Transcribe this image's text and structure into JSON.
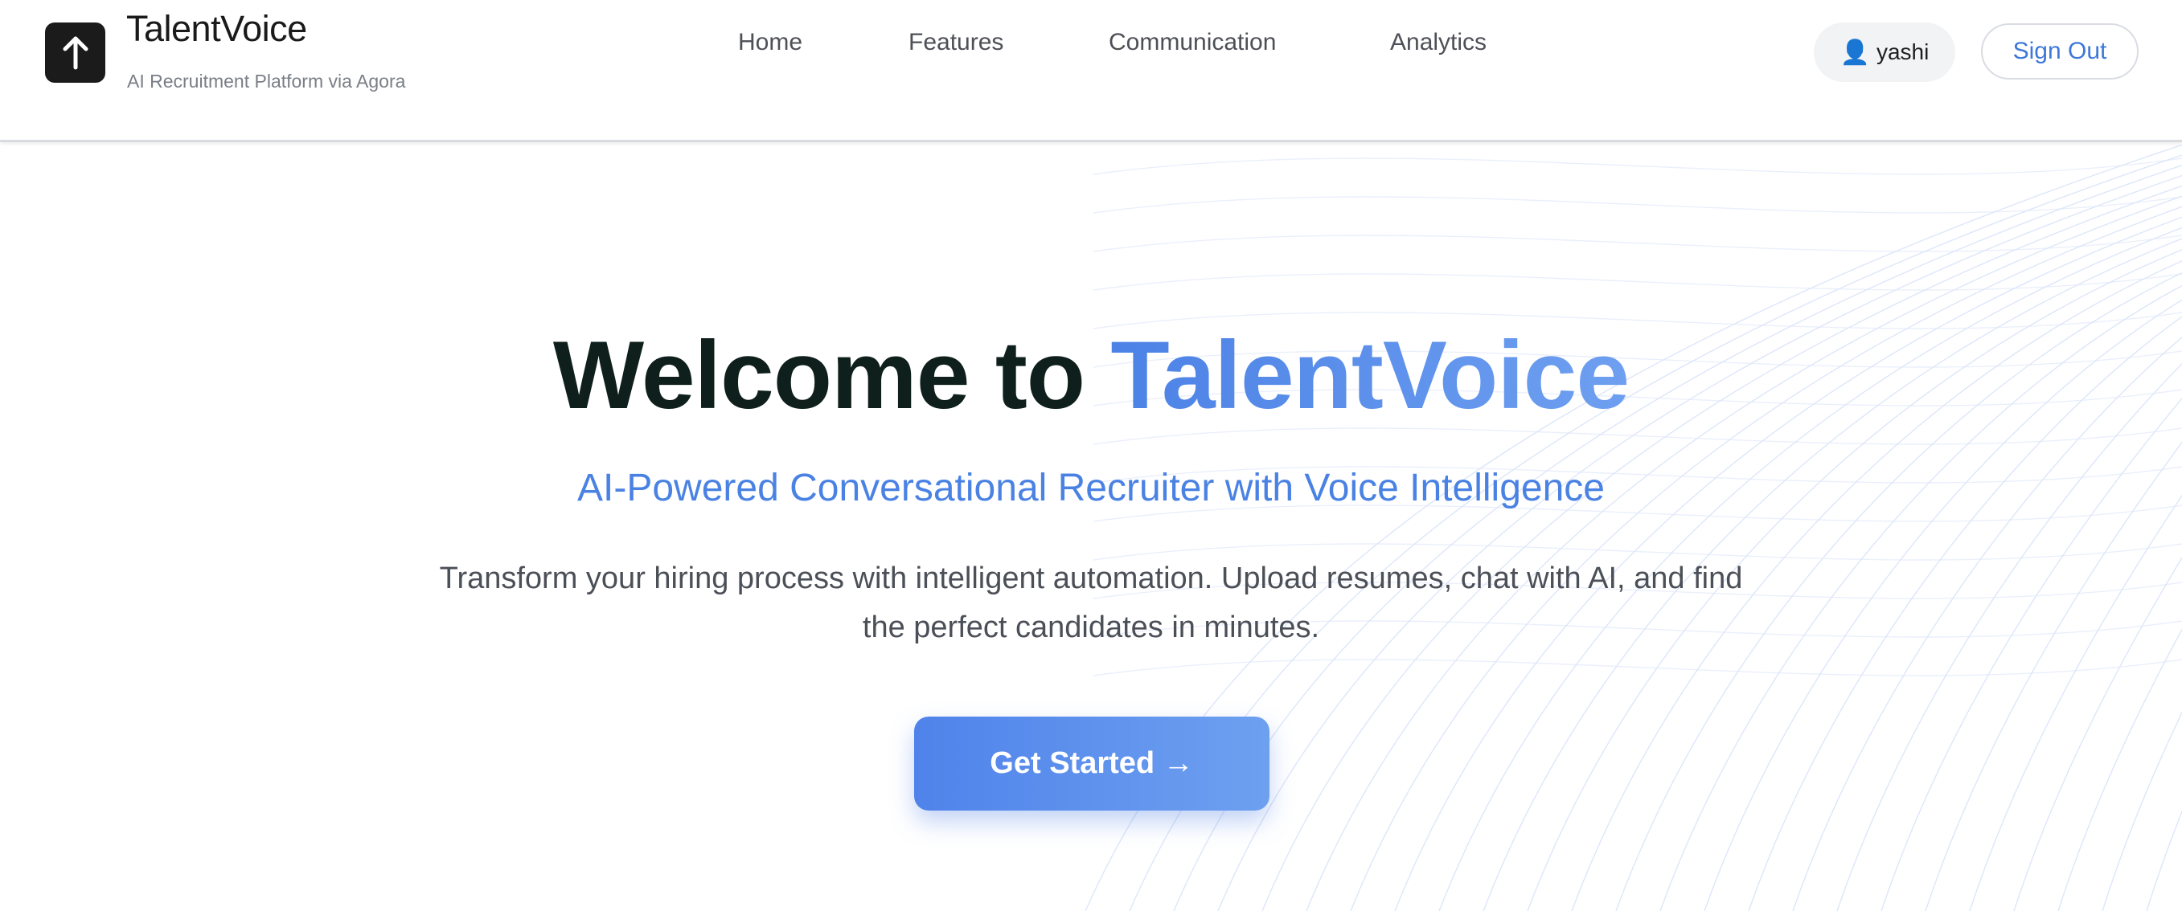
{
  "brand": {
    "name": "TalentVoice",
    "tagline": "AI Recruitment Platform via Agora",
    "logo_icon": "arrow-up-icon"
  },
  "nav": {
    "items": [
      {
        "label": "Home"
      },
      {
        "label": "Features"
      },
      {
        "label": "Communication"
      },
      {
        "label": "Analytics"
      }
    ]
  },
  "user": {
    "icon": "👤",
    "name": "yashi"
  },
  "actions": {
    "sign_out": "Sign Out"
  },
  "hero": {
    "title_prefix": "Welcome to ",
    "title_accent": "TalentVoice",
    "subtitle": "AI-Powered Conversational Recruiter with Voice Intelligence",
    "description": "Transform your hiring process with intelligent automation. Upload resumes, chat with AI, and find the perfect candidates in minutes.",
    "cta_label": "Get Started →"
  },
  "colors": {
    "accent": "#4a82e4",
    "title_dark": "#0e1f1c",
    "logo_bg": "#1b1b1b"
  }
}
